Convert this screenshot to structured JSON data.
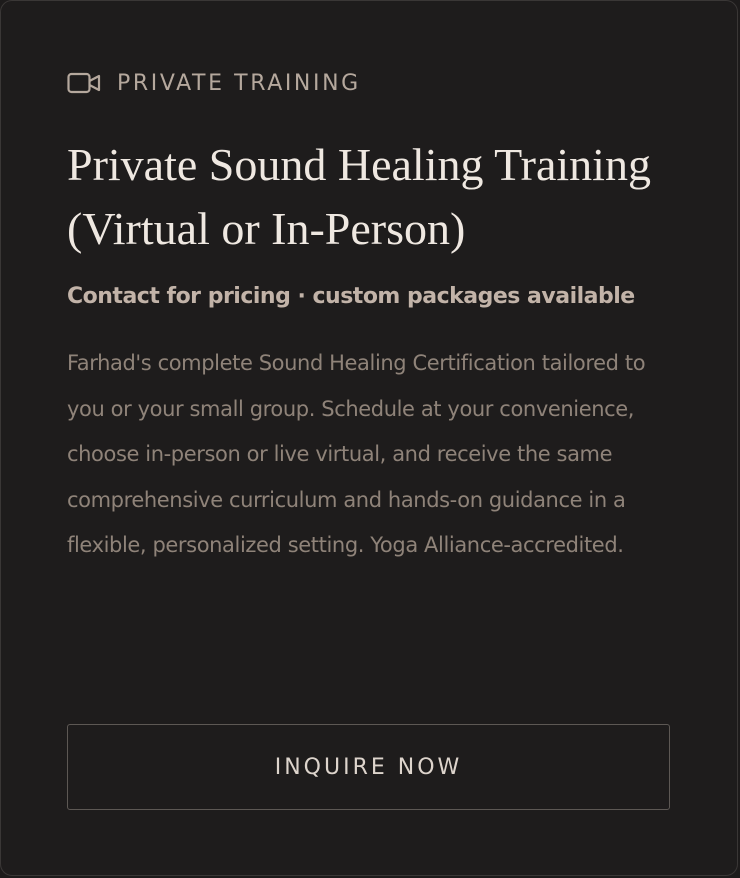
{
  "card": {
    "eyebrow": {
      "icon": "video-camera-icon",
      "label": "PRIVATE TRAINING"
    },
    "title": "Private Sound Healing Training (Virtual or In-Person)",
    "pricing": "Contact for pricing · custom packages available",
    "description": "Farhad's complete Sound Healing Certification tailored to you or your small group. Schedule at your convenience, choose in-person or live virtual, and receive the same comprehensive curriculum and hands-on guidance in a flexible, personalized setting. Yoga Alliance-accredited.",
    "cta_label": "INQUIRE NOW"
  },
  "colors": {
    "background": "#1e1c1c",
    "border": "#3a3736",
    "eyebrow": "#b5a89d",
    "title": "#efe8e1",
    "pricing": "#c2b3a8",
    "body": "#8f8379",
    "button_text": "#ddd4cc"
  }
}
